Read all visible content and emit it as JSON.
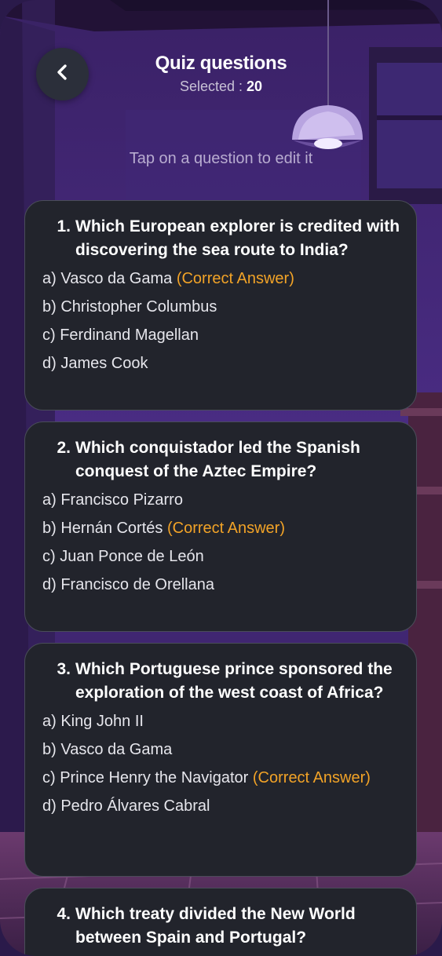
{
  "header": {
    "title": "Quiz questions",
    "selected_label": "Selected :",
    "selected_count": "20",
    "hint": "Tap on a question to edit it"
  },
  "correct_marker": "(Correct Answer)",
  "questions": [
    {
      "number": "1.",
      "text": "Which European explorer is credited with discovering the sea route to India?",
      "options": [
        {
          "text": "a) Vasco da Gama",
          "correct": "(Correct Answer)"
        },
        {
          "text": "b) Christopher Columbus"
        },
        {
          "text": "c) Ferdinand Magellan"
        },
        {
          "text": "d) James Cook"
        }
      ]
    },
    {
      "number": "2.",
      "text": "Which conquistador led the Spanish conquest of the Aztec Empire?",
      "options": [
        {
          "text": "a) Francisco Pizarro"
        },
        {
          "text": "b) Hernán Cortés",
          "correct": "(Correct Answer)"
        },
        {
          "text": "c) Juan Ponce de León"
        },
        {
          "text": "d) Francisco de Orellana"
        }
      ]
    },
    {
      "number": "3.",
      "text": "Which Portuguese prince sponsored the exploration of the west coast of Africa?",
      "options": [
        {
          "text": "a) King John II"
        },
        {
          "text": "b) Vasco da Gama"
        },
        {
          "text": "c) Prince Henry the Navigator",
          "correct": "(Correct Answer)"
        },
        {
          "text": "d) Pedro Álvares Cabral"
        }
      ]
    },
    {
      "number": "4.",
      "text": "Which treaty divided the New World between Spain and Portugal?",
      "options": []
    }
  ],
  "colors": {
    "card_bg": "#22242c",
    "accent_correct": "#f2a327",
    "back_button_bg": "#2b2f3a"
  },
  "icons": {
    "back": "chevron-left-icon",
    "lamp": "pendant-lamp-illustration"
  }
}
